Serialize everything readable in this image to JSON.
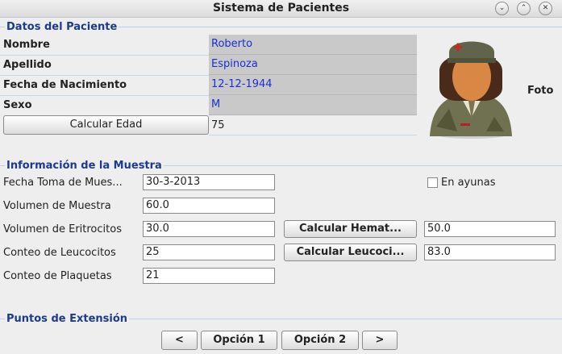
{
  "window": {
    "title": "Sistema de Pacientes",
    "controls": [
      "⌄",
      "⌃",
      "✕"
    ]
  },
  "patient": {
    "section_title": "Datos del Paciente",
    "fields": [
      {
        "label": "Nombre",
        "value": "Roberto"
      },
      {
        "label": "Apellido",
        "value": "Espinoza"
      },
      {
        "label": "Fecha de Nacimiento",
        "value": "12-12-1944"
      },
      {
        "label": "Sexo",
        "value": "M"
      }
    ],
    "calc_age_button": "Calcular Edad",
    "age_value": "75",
    "photo_label": "Foto"
  },
  "sample": {
    "section_title": "Información de la Muestra",
    "rows": [
      {
        "label": "Fecha Toma de Mues...",
        "value": "30-3-2013"
      },
      {
        "label": "Volumen de Muestra",
        "value": "60.0"
      },
      {
        "label": "Volumen de Eritrocitos",
        "value": "30.0"
      },
      {
        "label": "Conteo de Leucocitos",
        "value": "25"
      },
      {
        "label": "Conteo de Plaquetas",
        "value": "21"
      }
    ],
    "fasting_label": "En ayunas",
    "fasting_checked": false,
    "hemat_button": "Calcular Hemat...",
    "hemat_value": "50.0",
    "leuco_button": "Calcular Leucoci...",
    "leuco_value": "83.0"
  },
  "extension": {
    "section_title": "Puntos de Extensión",
    "prev_button": "<",
    "option1_button": "Opción 1",
    "option2_button": "Opción 2",
    "next_button": ">"
  }
}
